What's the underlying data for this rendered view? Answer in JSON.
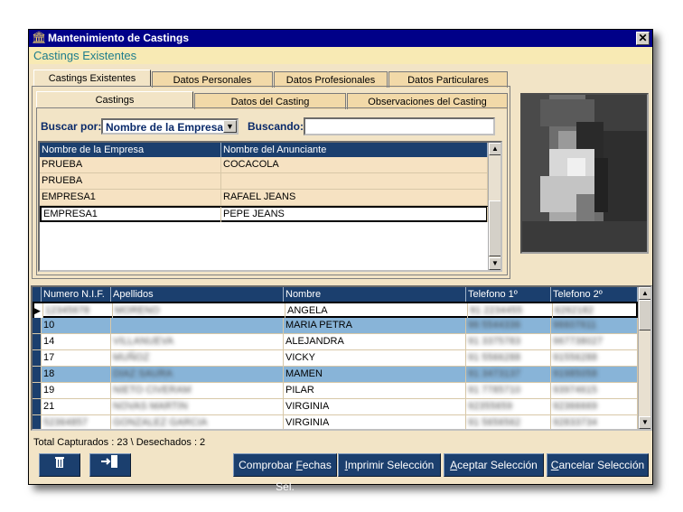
{
  "window": {
    "title": "Mantenimiento de Castings",
    "subtitle": "Castings Existentes",
    "close_glyph": "✕"
  },
  "top_tabs": [
    "Castings Existentes",
    "Datos Personales",
    "Datos Profesionales",
    "Datos Particulares"
  ],
  "sub_tabs": [
    "Castings",
    "Datos del Casting",
    "Observaciones del Casting"
  ],
  "search": {
    "by_label": "Buscar por:",
    "by_value": "Nombre de la Empresa",
    "searching_label": "Buscando:",
    "searching_value": ""
  },
  "castings_grid": {
    "columns": [
      "Nombre de la Empresa",
      "Nombre del Anunciante"
    ],
    "rows": [
      [
        "PRUEBA",
        "COCACOLA"
      ],
      [
        "PRUEBA",
        ""
      ],
      [
        "EMPRESA1",
        "RAFAEL JEANS"
      ],
      [
        "EMPRESA1",
        "PEPE JEANS"
      ]
    ]
  },
  "people_grid": {
    "columns": [
      "Numero N.I.F.",
      "Apellidos",
      "Nombre",
      "Telefono 1º",
      "Telefono 2º"
    ],
    "rows": [
      {
        "nif": "12345678",
        "apellidos": "MORENO",
        "nombre": "ANGELA",
        "tel1": "91 2234455",
        "tel2": "6262182"
      },
      {
        "nif": "10",
        "apellidos": "",
        "nombre": "MARIA PETRA",
        "tel1": "96 5544336",
        "tel2": "96607611"
      },
      {
        "nif": "14",
        "apellidos": "VILLANUEVA",
        "nombre": "ALEJANDRA",
        "tel1": "91 3375783",
        "tel2": "967738027"
      },
      {
        "nif": "17",
        "apellidos": "MUÑOZ",
        "nombre": "VICKY",
        "tel1": "91 5566288",
        "tel2": "91556288"
      },
      {
        "nif": "18",
        "apellidos": "DIAZ SAURA",
        "nombre": "MAMEN",
        "tel1": "91 3473137",
        "tel2": "91985058"
      },
      {
        "nif": "19",
        "apellidos": "NIETO CIVERAM",
        "nombre": "PILAR",
        "tel1": "91 7785710",
        "tel2": "93974615"
      },
      {
        "nif": "21",
        "apellidos": "NOVAS MARTIN",
        "nombre": "VIRGINIA",
        "tel1": "92355659",
        "tel2": "92366669"
      },
      {
        "nif": "52364857",
        "apellidos": "GONZALEZ GARCIA",
        "nombre": "VIRGINIA",
        "tel1": "91 5656562",
        "tel2": "92833734"
      }
    ]
  },
  "status": "Total Capturados : 23  \\  Desechados : 2",
  "buttons": {
    "delete_icon": "trash-icon",
    "exit_icon": "exit-door-icon",
    "check_dates_pre": "Comprobar ",
    "check_dates_u": "F",
    "check_dates_post": "echas Sel.",
    "print_u": "I",
    "print_post": "mprimir Selección",
    "accept_u": "A",
    "accept_post": "ceptar Selección",
    "cancel_u": "C",
    "cancel_post": "ancelar Selección"
  },
  "colors": {
    "window_bg": "#f2e4c6",
    "title_bar": "#000088",
    "grid_header": "#1b3f6e",
    "row_selected_blue": "#88b4d8",
    "row_tan": "#f6e2c2"
  }
}
